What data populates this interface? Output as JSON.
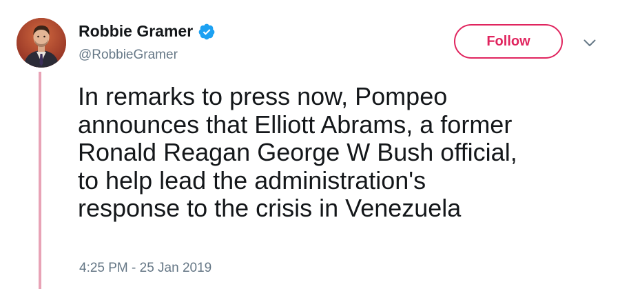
{
  "author": {
    "display_name": "Robbie Gramer",
    "handle": "@RobbieGramer",
    "verified_icon": "verified-badge-icon",
    "avatar_icon": "profile-avatar"
  },
  "actions": {
    "follow_label": "Follow",
    "menu_icon": "chevron-down-icon"
  },
  "tweet": {
    "lines": [
      "In remarks to press now, Pompeo",
      "announces that Elliott Abrams, a former",
      "Ronald Reagan George W Bush official,",
      "to help lead the administration's",
      "response to the crisis in Venezuela"
    ],
    "timestamp": "4:25 PM - 25 Jan 2019"
  },
  "colors": {
    "accent": "#e0245e",
    "verified": "#1da1f2",
    "muted_text": "#657786",
    "thread_line": "#e8a3b6"
  }
}
